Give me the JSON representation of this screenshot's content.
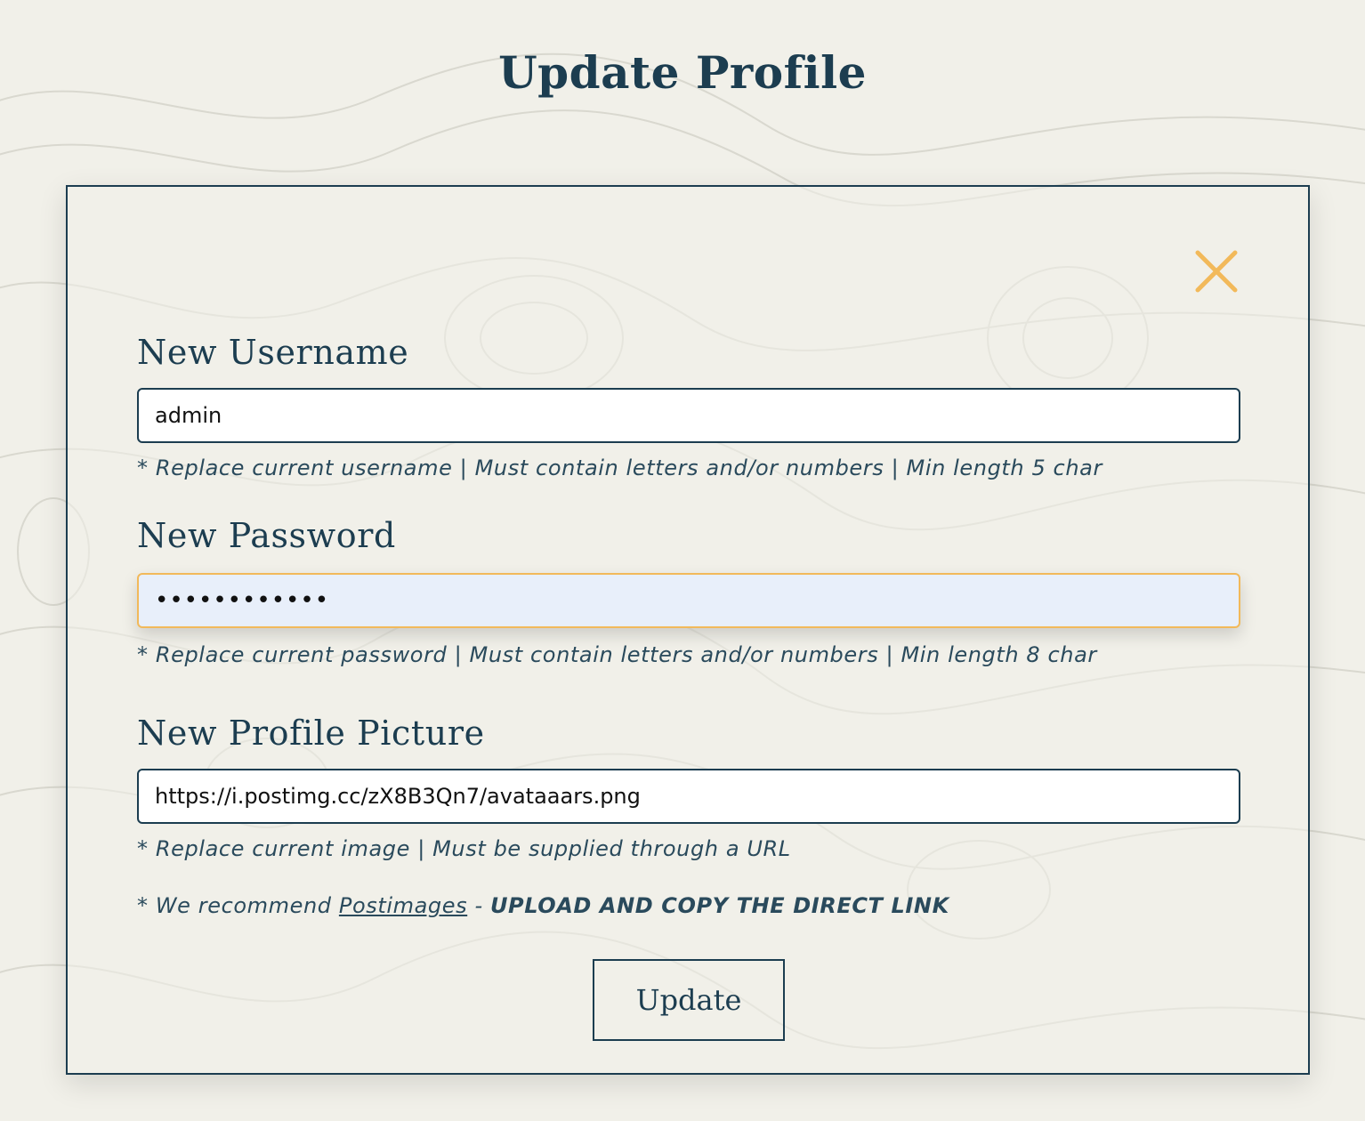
{
  "page": {
    "title": "Update Profile"
  },
  "colors": {
    "primary": "#1c3d50",
    "accent": "#f2b95a",
    "background": "#f1f0e9",
    "focused_input_bg": "#e8effa"
  },
  "modal": {
    "close_icon": "close-x-icon",
    "username": {
      "label": "New Username",
      "value": "admin",
      "hint": "* Replace current username | Must contain letters and/or numbers | Min length 5 char"
    },
    "password": {
      "label": "New Password",
      "value": "••••••••••••",
      "hint": "* Replace current password | Must contain letters and/or numbers | Min length 8 char"
    },
    "picture": {
      "label": "New Profile Picture",
      "value": "https://i.postimg.cc/zX8B3Qn7/avataaars.png",
      "hint": "* Replace current image | Must be supplied through a URL",
      "recommend_prefix": "* We recommend",
      "recommend_link": "Postimages",
      "recommend_sep": "-",
      "recommend_emphasis": "UPLOAD AND COPY THE DIRECT LINK"
    },
    "submit_label": "Update"
  }
}
